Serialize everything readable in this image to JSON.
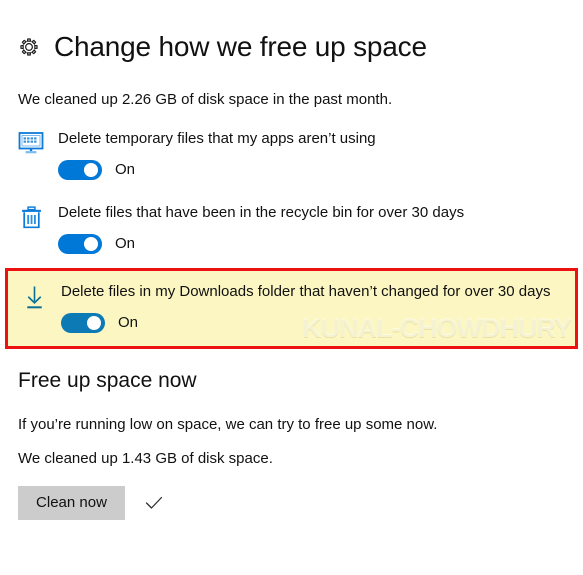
{
  "header": {
    "icon": "gear-icon",
    "title": "Change how we free up space"
  },
  "subtitle": "We cleaned up 2.26 GB of disk space in the past month.",
  "settings": [
    {
      "icon": "monitor-icon",
      "label": "Delete temporary files that my apps aren’t using",
      "toggle_state": "On",
      "highlighted": false
    },
    {
      "icon": "recycle-bin-icon",
      "label": "Delete files that have been in the recycle bin for over 30 days",
      "toggle_state": "On",
      "highlighted": false
    },
    {
      "icon": "download-icon",
      "label": "Delete files in my Downloads folder that haven’t changed for over 30 days",
      "toggle_state": "On",
      "highlighted": true,
      "watermark": "KUNAL-CHOWDHURY"
    }
  ],
  "free_up_section": {
    "heading": "Free up space now",
    "description": "If you’re running low on space, we can try to free up some now.",
    "result": "We cleaned up 1.43 GB of disk space.",
    "button_label": "Clean now",
    "status_icon": "checkmark-icon"
  },
  "colors": {
    "accent_blue": "#0078d7",
    "toggle_highlight_blue": "#0c7ab5",
    "highlight_background": "#fcf7c2",
    "highlight_border": "#ee1111",
    "button_background": "#cccccc",
    "text": "#111111"
  }
}
